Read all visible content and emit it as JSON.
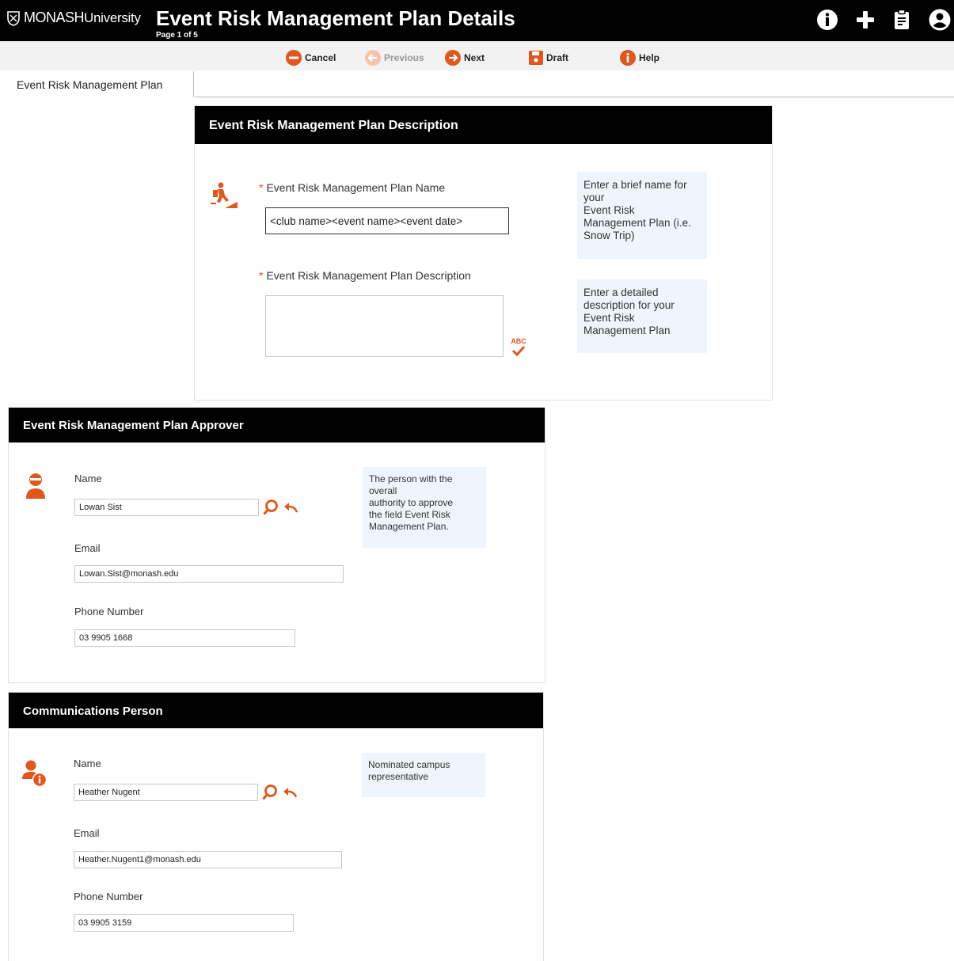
{
  "header": {
    "brand_main": "MONASH",
    "brand_sub": "University",
    "title": "Event Risk Management Plan Details",
    "page_info": "Page 1 of 5",
    "icons": [
      "info-icon",
      "plus-icon",
      "clipboard-icon",
      "user-icon"
    ]
  },
  "toolbar": {
    "cancel": "Cancel",
    "previous": "Previous",
    "next": "Next",
    "draft": "Draft",
    "help": "Help"
  },
  "tabs": [
    {
      "label": "Event Risk Management Plan",
      "active": true
    }
  ],
  "description_section": {
    "header": "Event Risk Management Plan Description",
    "name_label": "Event Risk Management Plan Name",
    "name_value": "<club name><event name><event date>",
    "name_help": "Enter a brief name for\nyour\nEvent Risk\nManagement Plan (i.e.\nSnow Trip)",
    "desc_label": "Event Risk Management Plan Description",
    "desc_value": "",
    "desc_help": "Enter a detailed\ndescription for your\nEvent Risk\nManagement Plan",
    "required_marker": "*",
    "spellcheck_text": "ABC"
  },
  "approver_section": {
    "header": "Event Risk Management Plan Approver",
    "name_label": "Name",
    "name_value": "Lowan Sist",
    "help": "The person with the\noverall\nauthority to approve\nthe field Event Risk\nManagement Plan.",
    "email_label": "Email",
    "email_value": "Lowan.Sist@monash.edu",
    "phone_label": "Phone Number",
    "phone_value": "03 9905 1668"
  },
  "communications_section": {
    "header": "Communications Person",
    "name_label": "Name",
    "name_value": "Heather Nugent",
    "help": "Nominated campus\nrepresentative",
    "email_label": "Email",
    "email_value": "Heather.Nugent1@monash.edu",
    "phone_label": "Phone Number",
    "phone_value": "03 9905 3159"
  },
  "colors": {
    "accent": "#e0561b",
    "header_bg": "#000000",
    "help_bg": "#eef5fc",
    "toolbar_bg": "#f2f2f2"
  }
}
